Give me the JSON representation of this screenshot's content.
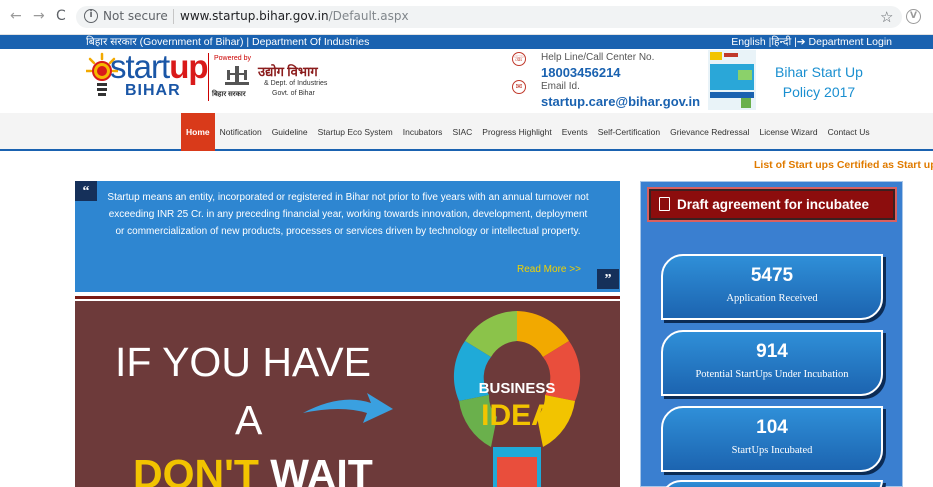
{
  "browser": {
    "security_label": "Not secure",
    "url_domain": "www.startup.bihar.gov.in",
    "url_path": "/Default.aspx"
  },
  "topbar": {
    "left_text": "बिहार सरकार (Government of Bihar)  |  Department Of Industries",
    "right_text": "English  |हिन्दी  |➔ Department Login"
  },
  "header": {
    "logo_start": "start",
    "logo_up": "up",
    "logo_bihar": "BIHAR",
    "powered_by": "Powered by",
    "udyog": "उद्योग  विभाग",
    "dept_line1": "&  Dept. of Industries",
    "dept_line2": "Govt. of Bihar",
    "bihar_sarkar": "बिहार सरकार",
    "helpline_label": "Help Line/Call Center No.",
    "helpline_number": "18003456214",
    "email_label": "Email Id.",
    "email_value": "startup.care@bihar.gov.in",
    "policy_title": "Bihar Start Up Policy 2017"
  },
  "nav": {
    "items": [
      "Home",
      "Notification",
      "Guideline",
      "Startup Eco System",
      "Incubators",
      "SIAC",
      "Progress Highlight",
      "Events",
      "Self-Certification",
      "Grievance Redressal",
      "License Wizard",
      "Contact Us"
    ]
  },
  "marquee": "List of Start ups Certified as Start ups",
  "quote": {
    "text": "Startup means an entity, incorporated or registered in Bihar not prior to five years with an annual turnover not exceeding INR 25 Cr. in any preceding financial year, working towards innovation, development, deployment or commercialization of new products, processes or services driven by technology or intellectual property.",
    "read_more": "Read More >>"
  },
  "banner": {
    "line1": "IF YOU HAVE",
    "line2": "A",
    "line3_highlight": "DON'T",
    "line3_rest": " WAIT",
    "bulb_line1": "BUSINESS",
    "bulb_line2": "IDEA"
  },
  "panel": {
    "draft_label": "Draft agreement for incubatee",
    "stats": [
      {
        "number": "5475",
        "label": "Application Received"
      },
      {
        "number": "914",
        "label": "Potential StartUps Under Incubation"
      },
      {
        "number": "104",
        "label": "StartUps Incubated"
      }
    ]
  },
  "colors": {
    "brand_blue": "#1a62b0",
    "nav_active": "#d93a1a",
    "draft_red": "#8c0d0d",
    "highlight_yellow": "#f2c400"
  }
}
